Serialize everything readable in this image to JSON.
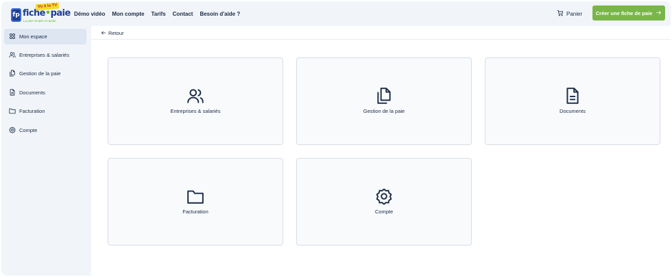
{
  "logo": {
    "badge_text": "fp",
    "tv_text": "Vu à la TV",
    "word_main": "fiche",
    "word_sep": "•",
    "word_end": "paie",
    "tagline": "La paie simple et rapide"
  },
  "nav": {
    "items": [
      "Démo vidéo",
      "Mon compte",
      "Tarifs",
      "Contact",
      "Besoin d'aide ?"
    ]
  },
  "cart": {
    "label": "Panier",
    "icon": "cart-icon"
  },
  "cta": {
    "label": "Créer une fiche de paie",
    "icon": "arrow-right-icon",
    "color": "#78b64a"
  },
  "sidebar": {
    "items": [
      {
        "label": "Mon espace",
        "icon": "dashboard-icon",
        "active": true
      },
      {
        "label": "Entreprises & salariés",
        "icon": "users-icon",
        "active": false
      },
      {
        "label": "Gestion de la paie",
        "icon": "files-icon",
        "active": false
      },
      {
        "label": "Documents",
        "icon": "document-icon",
        "active": false
      },
      {
        "label": "Facturation",
        "icon": "folder-icon",
        "active": false
      },
      {
        "label": "Compte",
        "icon": "settings-icon",
        "active": false
      }
    ]
  },
  "back": {
    "label": "Retour",
    "icon": "arrow-left-icon"
  },
  "cards": [
    {
      "label": "Entreprises & salariés",
      "icon": "users-icon"
    },
    {
      "label": "Gestion de la paie",
      "icon": "files-icon"
    },
    {
      "label": "Documents",
      "icon": "document-icon"
    },
    {
      "label": "Facturation",
      "icon": "folder-icon"
    },
    {
      "label": "Compte",
      "icon": "settings-icon"
    }
  ],
  "colors": {
    "accent": "#78b64a",
    "brand_blue": "#1d3f8c",
    "text": "#1b2b45",
    "sidebar_bg": "#f1f5f9",
    "active_bg": "#dde6f1"
  }
}
